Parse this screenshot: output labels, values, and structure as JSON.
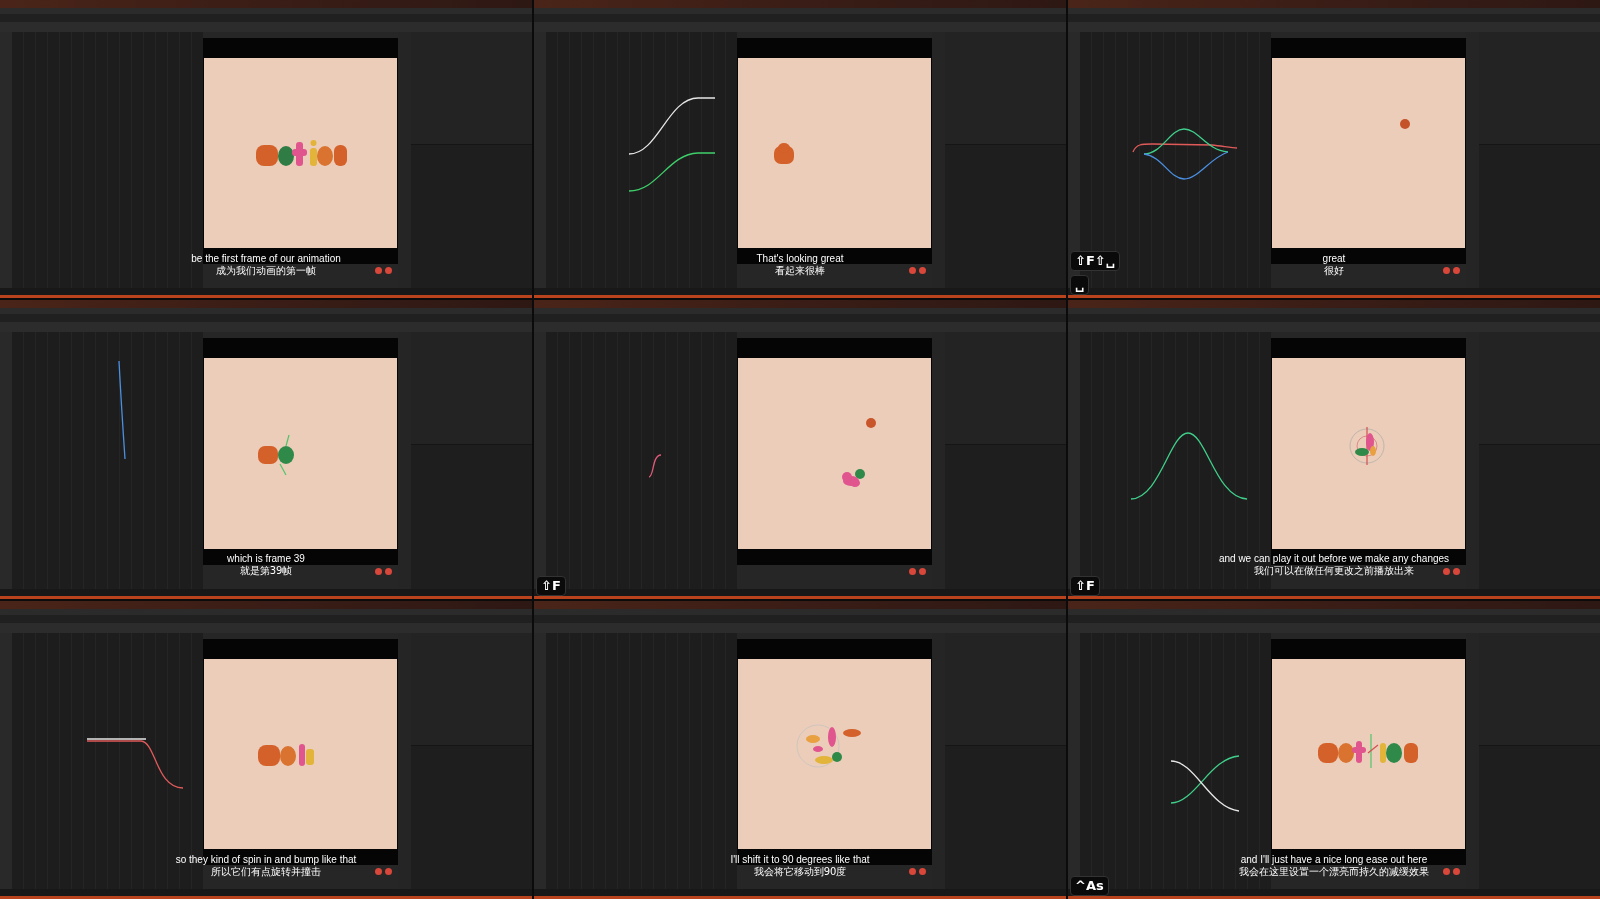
{
  "frames": [
    {
      "viewport": {
        "kind": "word"
      },
      "caption_en": "be the first frame of our animation",
      "caption_zh": "成为我们动画的第一帧"
    },
    {
      "viewport": {
        "kind": "blob"
      },
      "graph": {
        "kind": "s-curves"
      },
      "caption_en": "That's looking great",
      "caption_zh": "看起来很棒"
    },
    {
      "viewport": {
        "kind": "ball"
      },
      "graph": {
        "kind": "waves"
      },
      "caption_en": "great",
      "caption_zh": "很好",
      "keys": [
        "⇧F⇧␣",
        "␣"
      ]
    },
    {
      "viewport": {
        "kind": "letter-ball"
      },
      "graph": {
        "kind": "drop"
      },
      "caption_en": "which is frame 39",
      "caption_zh": "就是第39帧"
    },
    {
      "viewport": {
        "kind": "ball-blob"
      },
      "graph": {
        "kind": "small-s"
      },
      "keys": [
        "⇧F"
      ]
    },
    {
      "viewport": {
        "kind": "gizmo-blob"
      },
      "graph": {
        "kind": "bell"
      },
      "caption_en": "and we can play it out before we make any changes",
      "caption_zh": "我们可以在做任何更改之前播放出来",
      "keys": [
        "⇧F"
      ]
    },
    {
      "viewport": {
        "kind": "partial-word"
      },
      "graph": {
        "kind": "ease-down"
      },
      "caption_en": "so they kind of spin in and bump like that",
      "caption_zh": "所以它们有点旋转并撞击"
    },
    {
      "viewport": {
        "kind": "gizmo-shapes"
      },
      "caption_en": "I'll shift it to 90 degrees like that",
      "caption_zh": "我会将它移动到90度"
    },
    {
      "viewport": {
        "kind": "word-gizmo"
      },
      "graph": {
        "kind": "cross"
      },
      "caption_en": "and I'll just have a nice long ease out here",
      "caption_zh": "我会在这里设置一个漂亮而持久的减缓效果",
      "keys": [
        "^As"
      ]
    }
  ]
}
